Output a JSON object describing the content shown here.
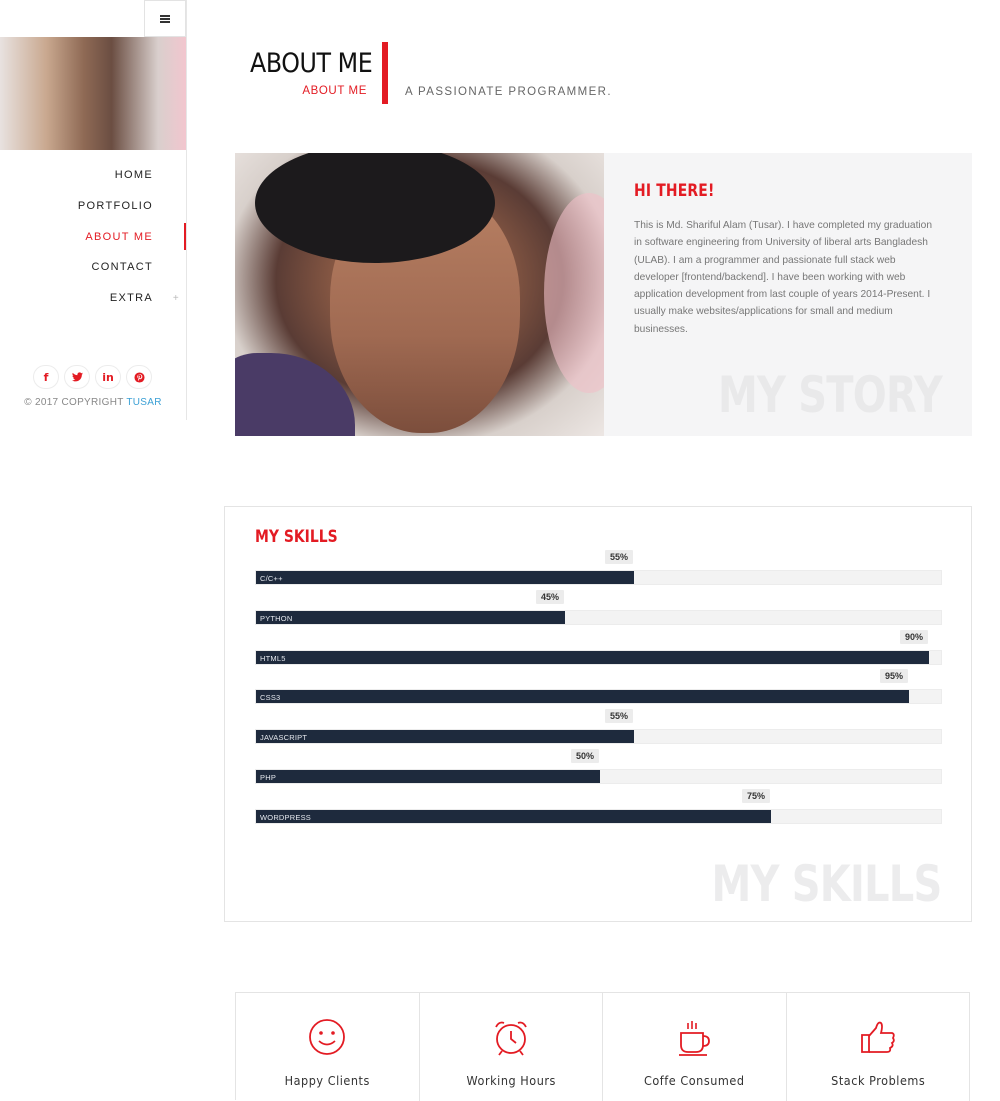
{
  "sidebar": {
    "nav": [
      {
        "label": "HOME",
        "active": false
      },
      {
        "label": "PORTFOLIO",
        "active": false
      },
      {
        "label": "ABOUT ME",
        "active": true
      },
      {
        "label": "CONTACT",
        "active": false
      },
      {
        "label": "EXTRA",
        "active": false,
        "has_submenu": true
      }
    ],
    "submenu_symbol": "+",
    "socials": [
      {
        "icon": "facebook-icon",
        "glyph": "f"
      },
      {
        "icon": "twitter-icon",
        "glyph": "🐦"
      },
      {
        "icon": "linkedin-icon",
        "glyph": "in"
      },
      {
        "icon": "pinterest-icon",
        "glyph": "℗"
      }
    ],
    "copyright_prefix": "© 2017 COPYRIGHT",
    "copyright_brand": "TUSAR"
  },
  "header": {
    "title": "ABOUT ME",
    "subtitle": "ABOUT ME",
    "tagline": "A PASSIONATE PROGRAMMER."
  },
  "story": {
    "heading": "HI THERE!",
    "text": "This is Md. Shariful Alam (Tusar). I have completed my graduation in software engineering from University of liberal arts Bangladesh (ULAB). I am a programmer and passionate full stack web developer [frontend/backend]. I have been working with web application development from last couple of years 2014-Present. I usually make websites/applications for small and medium businesses.",
    "watermark": "MY STORY"
  },
  "skills": {
    "heading": "MY SKILLS",
    "watermark": "MY SKILLS",
    "items": [
      {
        "name": "C/C++",
        "percent": 55,
        "label": "55%"
      },
      {
        "name": "PYTHON",
        "percent": 45,
        "label": "45%"
      },
      {
        "name": "HTML5",
        "percent": 98,
        "label": "90%"
      },
      {
        "name": "CSS3",
        "percent": 95,
        "label": "95%"
      },
      {
        "name": "JAVASCRIPT",
        "percent": 55,
        "label": "55%"
      },
      {
        "name": "PHP",
        "percent": 50,
        "label": "50%"
      },
      {
        "name": "WORDPRESS",
        "percent": 75,
        "label": "75%"
      }
    ]
  },
  "stats": [
    {
      "icon": "smiley-icon",
      "label": "Happy Clients"
    },
    {
      "icon": "alarm-clock-icon",
      "label": "Working Hours"
    },
    {
      "icon": "coffee-cup-icon",
      "label": "Coffe Consumed"
    },
    {
      "icon": "thumbs-up-icon",
      "label": "Stack Problems"
    }
  ],
  "colors": {
    "accent": "#e31b23",
    "bar_fill": "#1e2a3d",
    "link_blue": "#3ba0d5"
  }
}
